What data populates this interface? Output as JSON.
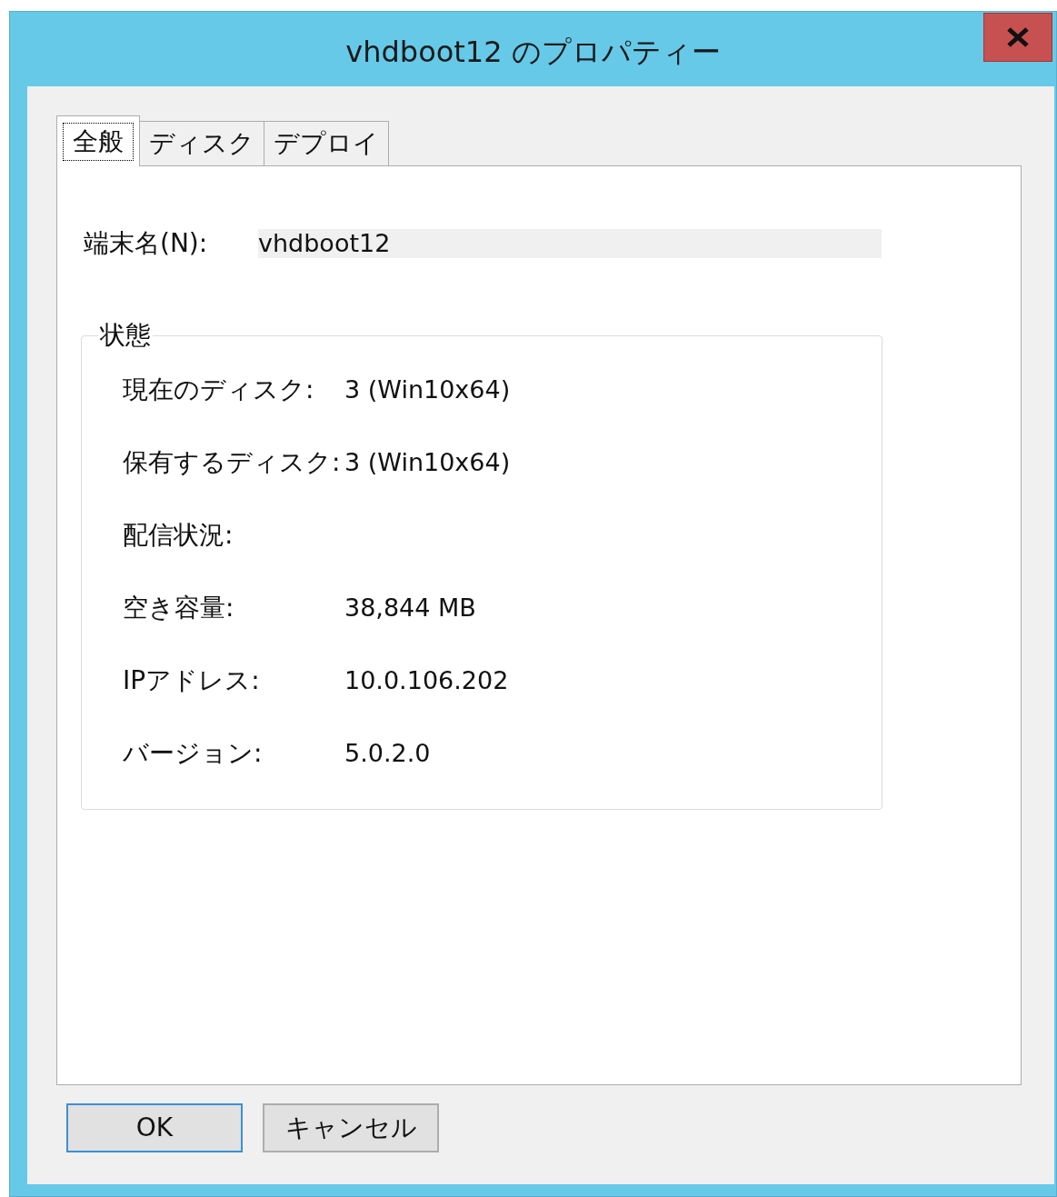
{
  "window": {
    "title": "vhdboot12 のプロパティー"
  },
  "tabs": [
    {
      "label": "全般",
      "selected": true
    },
    {
      "label": "ディスク",
      "selected": false
    },
    {
      "label": "デプロイ",
      "selected": false
    }
  ],
  "terminal_name": {
    "label": "端末名(N):",
    "value": "vhdboot12"
  },
  "status_group": {
    "title": "状態",
    "rows": [
      {
        "label": "現在のディスク:",
        "value": "3 (Win10x64)"
      },
      {
        "label": "保有するディスク:",
        "value": "3 (Win10x64)"
      },
      {
        "label": "配信状況:"
      },
      {
        "label": "空き容量:",
        "value": "38,844 MB"
      },
      {
        "label": "IPアドレス:",
        "value": "10.0.106.202"
      },
      {
        "label": "バージョン:",
        "value": "5.0.2.0"
      }
    ]
  },
  "buttons": [
    {
      "label": "OK",
      "default": true
    },
    {
      "label": "キャンセル",
      "default": false
    }
  ]
}
